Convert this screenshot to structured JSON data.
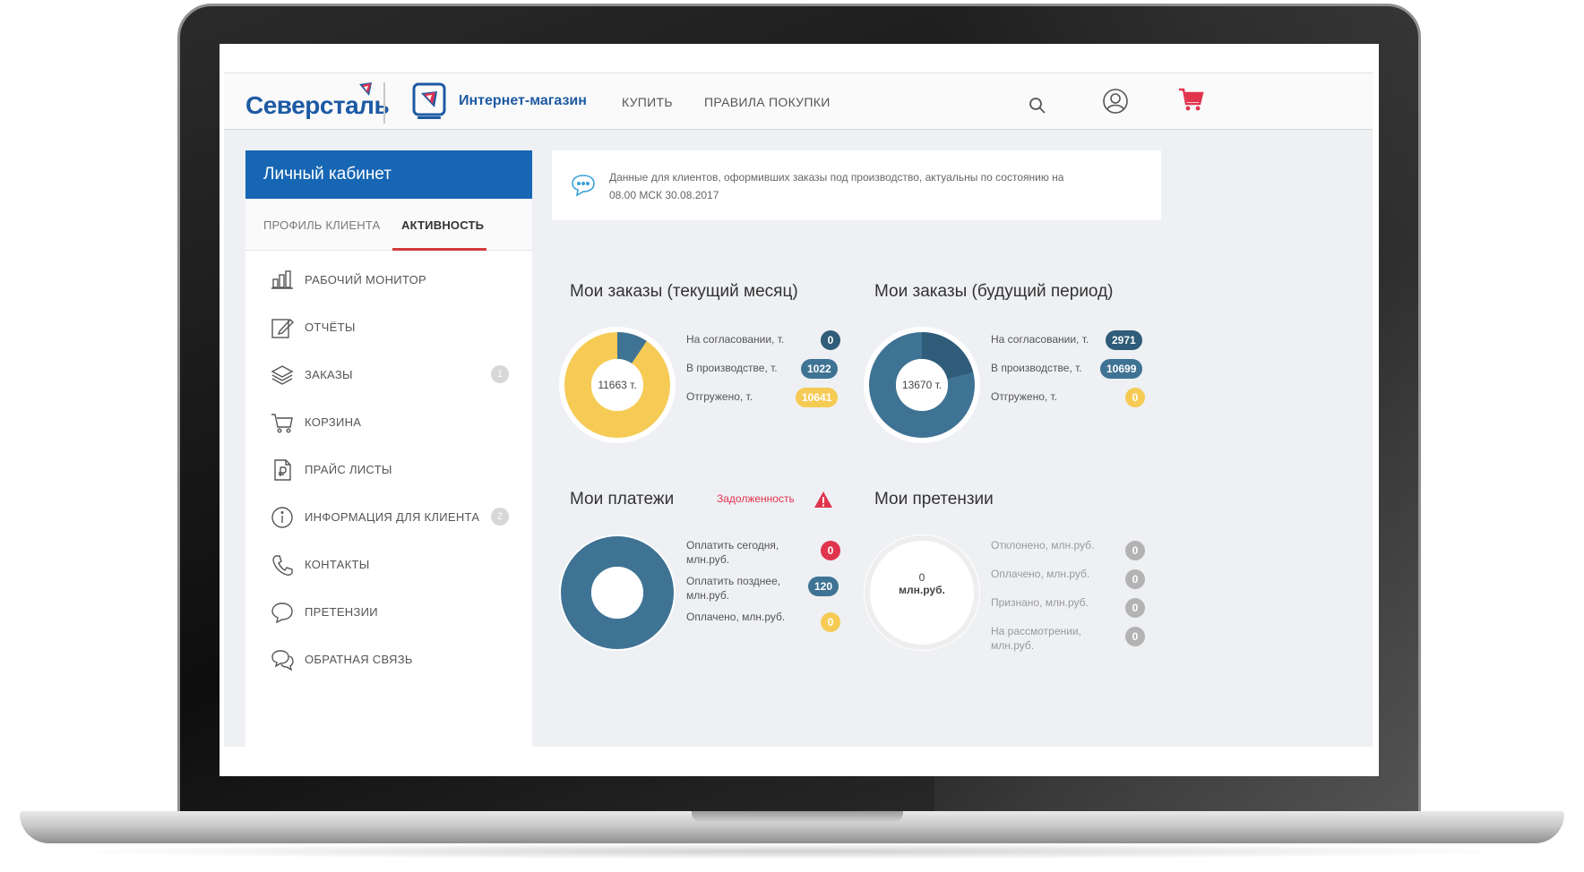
{
  "colors": {
    "brand_blue": "#1666b4",
    "teal": "#3f7394",
    "dark_teal": "#2f5c78",
    "yellow": "#f6cb55",
    "red": "#e0344d",
    "grey_badge": "#b3b3b3",
    "light_grey": "#eeeeee"
  },
  "header": {
    "logo": "Северсталь",
    "shop_label": "Интернет-магазин",
    "nav": [
      "КУПИТЬ",
      "ПРАВИЛА ПОКУПКИ"
    ],
    "icons": [
      "search-icon",
      "user-icon",
      "cart-icon"
    ]
  },
  "sidebar": {
    "title": "Личный кабинет",
    "tabs": [
      "ПРОФИЛЬ КЛИЕНТА",
      "АКТИВНОСТЬ"
    ],
    "active_tab": "АКТИВНОСТЬ",
    "items": [
      {
        "label": "РАБОЧИЙ МОНИТОР",
        "icon": "monitor-icon",
        "badge": ""
      },
      {
        "label": "ОТЧЁТЫ",
        "icon": "edit-icon",
        "badge": ""
      },
      {
        "label": "ЗАКАЗЫ",
        "icon": "layers-icon",
        "badge": "1"
      },
      {
        "label": "КОРЗИНА",
        "icon": "cart-icon",
        "badge": ""
      },
      {
        "label": "ПРАЙС ЛИСТЫ",
        "icon": "price-list-icon",
        "badge": ""
      },
      {
        "label": "ИНФОРМАЦИЯ ДЛЯ КЛИЕНТА",
        "icon": "info-icon",
        "badge": "2"
      },
      {
        "label": "КОНТАКТЫ",
        "icon": "phone-icon",
        "badge": ""
      },
      {
        "label": "ПРЕТЕНЗИИ",
        "icon": "chat-icon",
        "badge": ""
      },
      {
        "label": "ОБРАТНАЯ СВЯЗЬ",
        "icon": "feedback-icon",
        "badge": ""
      }
    ]
  },
  "info": {
    "text": "Данные для клиентов, оформивших заказы под производство, актуальны по состоянию на 08.00 МСК 30.08.2017"
  },
  "widgets": {
    "orders_current": {
      "title": "Мои заказы (текущий месяц)",
      "center": "11663 т.",
      "rows": [
        {
          "label": "На согласовании, т.",
          "value": "0",
          "color": "#2f5c78"
        },
        {
          "label": "В производстве, т.",
          "value": "1022",
          "color": "#3f7394"
        },
        {
          "label": "Отгружено, т.",
          "value": "10641",
          "color": "#f6cb55"
        }
      ]
    },
    "orders_future": {
      "title": "Мои заказы (будущий период)",
      "center": "13670 т.",
      "rows": [
        {
          "label": "На согласовании, т.",
          "value": "2971",
          "color": "#2f5c78"
        },
        {
          "label": "В производстве, т.",
          "value": "10699",
          "color": "#3f7394"
        },
        {
          "label": "Отгружено, т.",
          "value": "0",
          "color": "#f6cb55"
        }
      ]
    },
    "payments": {
      "title": "Мои платежи",
      "debt_label": "Задолженность",
      "rows": [
        {
          "label": "Оплатить сегодня, млн.руб.",
          "value": "0",
          "color": "#e0344d"
        },
        {
          "label": "Оплатить позднее, млн.руб.",
          "value": "120",
          "color": "#3f7394"
        },
        {
          "label": "Оплачено, млн.руб.",
          "value": "0",
          "color": "#f6cb55"
        }
      ]
    },
    "claims": {
      "title": "Мои претензии",
      "center_value": "0",
      "center_unit": "млн.руб.",
      "rows": [
        {
          "label": "Отклонено, млн.руб.",
          "value": "0"
        },
        {
          "label": "Оплачено, млн.руб.",
          "value": "0"
        },
        {
          "label": "Признано, млн.руб.",
          "value": "0"
        },
        {
          "label": "На рассмотрении, млн.руб.",
          "value": "0"
        }
      ]
    }
  }
}
